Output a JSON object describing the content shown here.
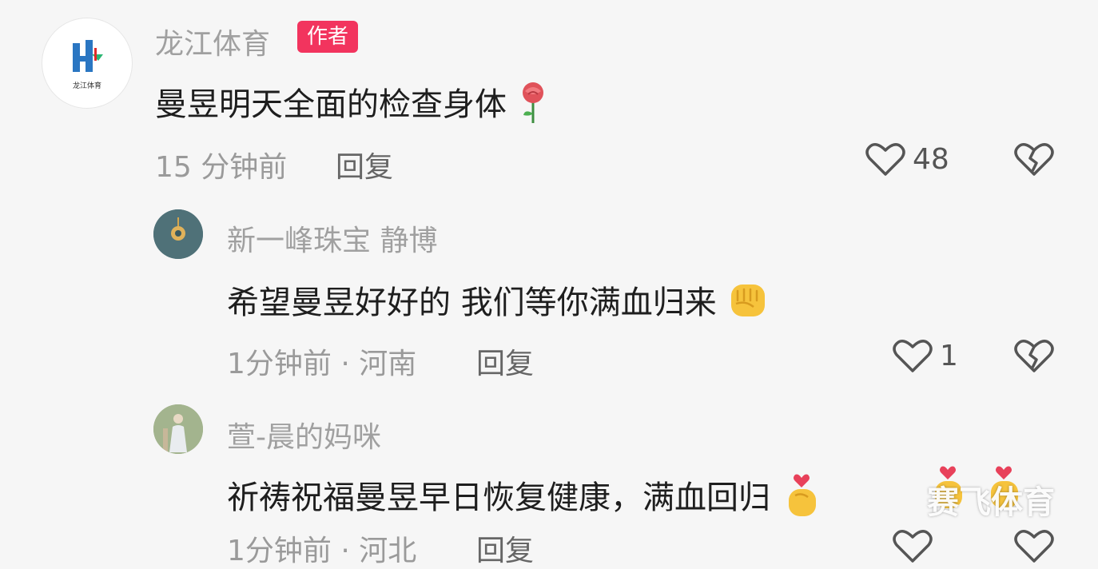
{
  "comments": [
    {
      "author": "龙江体育",
      "badge": "作者",
      "text": "曼昱明天全面的检查身体",
      "emoji": "rose-icon",
      "time": "15 分钟前",
      "reply": "回复",
      "likes": "48"
    },
    {
      "author": "新一峰珠宝 静博",
      "text": "希望曼昱好好的 我们等你满血归来",
      "emoji": "fist-icon",
      "time": "1分钟前 · 河南",
      "reply": "回复",
      "likes": "1"
    },
    {
      "author": "萱-晨的妈咪",
      "text": "祈祷祝福曼昱早日恢复健康，满血回归",
      "emoji": "finger-heart-icon",
      "time": "1分钟前 · 河北",
      "reply": "回复"
    }
  ],
  "logo": {
    "text": "龙江体育"
  },
  "watermark": "赛飞体育",
  "colors": {
    "badge": "#f2345e",
    "background": "#f6f6f6",
    "text": "#1e1e1e",
    "meta": "#9a9a9a"
  }
}
